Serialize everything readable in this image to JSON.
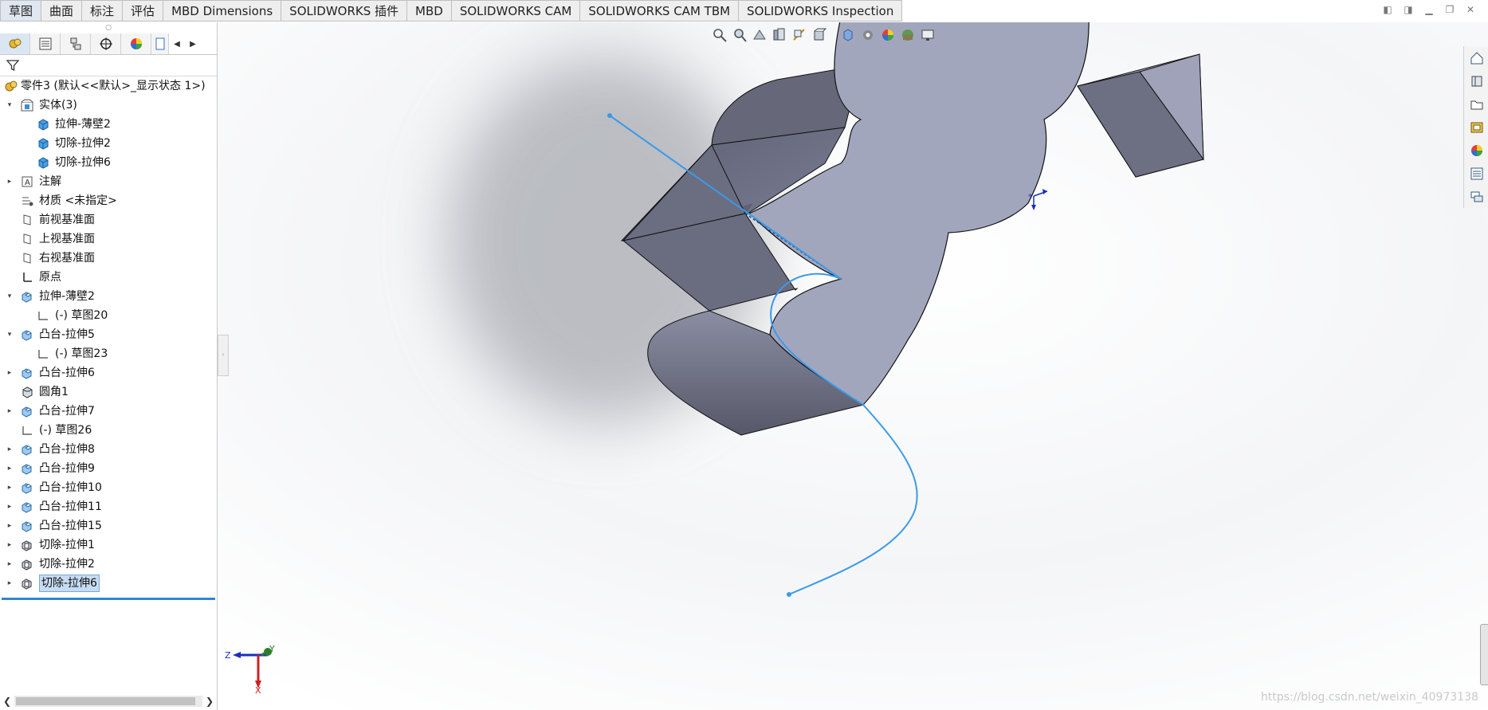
{
  "screen": {
    "width": 1867,
    "height": 891
  },
  "tabs": [
    {
      "label": "草图",
      "active": true
    },
    {
      "label": "曲面",
      "active": false
    },
    {
      "label": "标注",
      "active": false
    },
    {
      "label": "评估",
      "active": false
    },
    {
      "label": "MBD Dimensions",
      "active": false
    },
    {
      "label": "SOLIDWORKS 插件",
      "active": false
    },
    {
      "label": "MBD",
      "active": false
    },
    {
      "label": "SOLIDWORKS CAM",
      "active": false
    },
    {
      "label": "SOLIDWORKS CAM TBM",
      "active": false
    },
    {
      "label": "SOLIDWORKS Inspection",
      "active": false
    }
  ],
  "feature_tree": {
    "root": "零件3 (默认<<默认>_显示状态 1>)",
    "items": [
      {
        "label": "实体(3)",
        "level": 1,
        "expand": "expanded",
        "icon": "solid-bodies-folder-icon"
      },
      {
        "label": "拉伸-薄壁2",
        "level": 2,
        "expand": "none",
        "icon": "solid-body-icon"
      },
      {
        "label": "切除-拉伸2",
        "level": 2,
        "expand": "none",
        "icon": "solid-body-icon"
      },
      {
        "label": "切除-拉伸6",
        "level": 2,
        "expand": "none",
        "icon": "solid-body-icon"
      },
      {
        "label": "注解",
        "level": 1,
        "expand": "collapsed",
        "icon": "annotations-icon"
      },
      {
        "label": "材质 <未指定>",
        "level": 1,
        "expand": "none",
        "icon": "material-icon"
      },
      {
        "label": "前视基准面",
        "level": 1,
        "expand": "none",
        "icon": "plane-icon"
      },
      {
        "label": "上视基准面",
        "level": 1,
        "expand": "none",
        "icon": "plane-icon"
      },
      {
        "label": "右视基准面",
        "level": 1,
        "expand": "none",
        "icon": "plane-icon"
      },
      {
        "label": "原点",
        "level": 1,
        "expand": "none",
        "icon": "origin-icon"
      },
      {
        "label": "拉伸-薄壁2",
        "level": 1,
        "expand": "expanded",
        "icon": "extrude-icon"
      },
      {
        "label": "(-) 草图20",
        "level": 2,
        "expand": "none",
        "icon": "sketch-icon"
      },
      {
        "label": "凸台-拉伸5",
        "level": 1,
        "expand": "expanded",
        "icon": "extrude-icon"
      },
      {
        "label": "(-) 草图23",
        "level": 2,
        "expand": "none",
        "icon": "sketch-icon"
      },
      {
        "label": "凸台-拉伸6",
        "level": 1,
        "expand": "collapsed",
        "icon": "extrude-icon"
      },
      {
        "label": "圆角1",
        "level": 1,
        "expand": "none",
        "icon": "fillet-icon"
      },
      {
        "label": "凸台-拉伸7",
        "level": 1,
        "expand": "collapsed",
        "icon": "extrude-icon"
      },
      {
        "label": "(-) 草图26",
        "level": 1,
        "expand": "none",
        "icon": "sketch-icon"
      },
      {
        "label": "凸台-拉伸8",
        "level": 1,
        "expand": "collapsed",
        "icon": "extrude-icon"
      },
      {
        "label": "凸台-拉伸9",
        "level": 1,
        "expand": "collapsed",
        "icon": "extrude-icon"
      },
      {
        "label": "凸台-拉伸10",
        "level": 1,
        "expand": "collapsed",
        "icon": "extrude-icon"
      },
      {
        "label": "凸台-拉伸11",
        "level": 1,
        "expand": "collapsed",
        "icon": "extrude-icon"
      },
      {
        "label": "凸台-拉伸15",
        "level": 1,
        "expand": "collapsed",
        "icon": "extrude-icon"
      },
      {
        "label": "切除-拉伸1",
        "level": 1,
        "expand": "collapsed",
        "icon": "cut-extrude-icon"
      },
      {
        "label": "切除-拉伸2",
        "level": 1,
        "expand": "collapsed",
        "icon": "cut-extrude-icon"
      },
      {
        "label": "切除-拉伸6",
        "level": 1,
        "expand": "collapsed",
        "icon": "cut-extrude-icon",
        "selected": true
      }
    ]
  },
  "triad": {
    "z": "Z",
    "y": "Y",
    "x": "X"
  },
  "watermark": "https://blog.csdn.net/weixin_40973138",
  "colors": {
    "accent": "#2f86d4",
    "curve": "#3b9ae8",
    "model_top": "#a2a6bd",
    "model_side": "#6c6e82"
  }
}
